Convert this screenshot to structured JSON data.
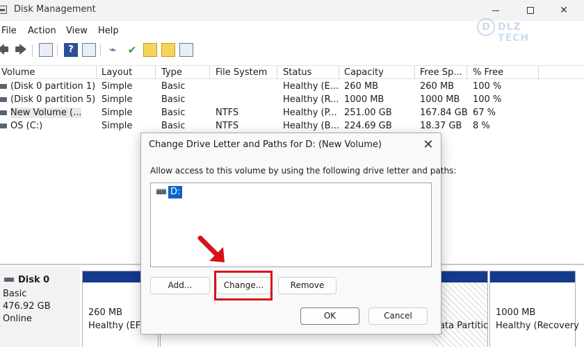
{
  "window": {
    "title": "Disk Management",
    "minimize_icon": "minimize-icon",
    "maximize_icon": "maximize-icon",
    "close_icon": "close-icon"
  },
  "watermark": {
    "logo_text": "D",
    "text": "DLZ TECH"
  },
  "menu": [
    "File",
    "Action",
    "View",
    "Help"
  ],
  "toolbar": {
    "icons": [
      "back-arrow-icon",
      "forward-arrow-icon",
      "console-tree-icon",
      "help-icon",
      "properties-icon",
      "connect-icon",
      "checklist-icon",
      "upload-icon",
      "search-icon",
      "list-view-icon"
    ]
  },
  "volumes": {
    "columns": [
      "Volume",
      "Layout",
      "Type",
      "File System",
      "Status",
      "Capacity",
      "Free Sp...",
      "% Free"
    ],
    "rows": [
      {
        "volume": "(Disk 0 partition 1)",
        "layout": "Simple",
        "type": "Basic",
        "fs": "",
        "status": "Healthy (E...",
        "capacity": "260 MB",
        "free": "260 MB",
        "pct": "100 %"
      },
      {
        "volume": "(Disk 0 partition 5)",
        "layout": "Simple",
        "type": "Basic",
        "fs": "",
        "status": "Healthy (R...",
        "capacity": "1000 MB",
        "free": "1000 MB",
        "pct": "100 %"
      },
      {
        "volume": "New Volume (...",
        "layout": "Simple",
        "type": "Basic",
        "fs": "NTFS",
        "status": "Healthy (P...",
        "capacity": "251.00 GB",
        "free": "167.84 GB",
        "pct": "67 %"
      },
      {
        "volume": "OS (C:)",
        "layout": "Simple",
        "type": "Basic",
        "fs": "NTFS",
        "status": "Healthy (B...",
        "capacity": "224.69 GB",
        "free": "18.37 GB",
        "pct": "8 %"
      }
    ]
  },
  "disk": {
    "name": "Disk 0",
    "type": "Basic",
    "size": "476.92 GB",
    "state": "Online",
    "partitions": [
      {
        "size": "260 MB",
        "status": "Healthy (EFI"
      },
      {
        "size": "",
        "status": "ata Partitic"
      },
      {
        "size": "1000 MB",
        "status": "Healthy (Recovery"
      }
    ]
  },
  "dialog": {
    "title": "Change Drive Letter and Paths for D: (New Volume)",
    "instruction": "Allow access to this volume by using the following drive letter and paths:",
    "paths": [
      "D:"
    ],
    "buttons": {
      "add": "Add...",
      "change": "Change...",
      "remove": "Remove",
      "ok": "OK",
      "cancel": "Cancel"
    }
  },
  "colors": {
    "partition_bar": "#143a8c",
    "selection": "#0a64c8",
    "highlight": "#d6121a"
  }
}
